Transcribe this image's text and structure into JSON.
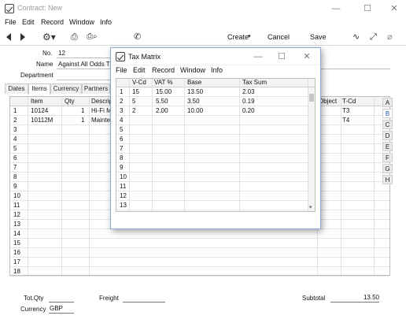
{
  "app": {
    "title": "Contract: New"
  },
  "window_buttons": {
    "minimize": "—",
    "maximize": "☐",
    "close": "✕"
  },
  "menu": [
    "File",
    "Edit",
    "Record",
    "Window",
    "Info"
  ],
  "toolbar": {
    "create_label": "Create",
    "cancel_label": "Cancel",
    "save_label": "Save"
  },
  "header": {
    "no_label": "No.",
    "no_value": "12",
    "name_label": "Name",
    "name_value": "Against All Odds Tra",
    "department_label": "Department",
    "department_value": ""
  },
  "tabs": [
    "Dates",
    "Items",
    "Currency",
    "Partners"
  ],
  "items_grid": {
    "columns": [
      "Item",
      "Qty",
      "Descrip",
      "Object",
      "T-Cd"
    ],
    "rows": [
      {
        "n": "1",
        "item": "10124",
        "qty": "1",
        "desc": "Hi-Fi M",
        "tcd": "T3"
      },
      {
        "n": "2",
        "item": "10112M",
        "qty": "1",
        "desc": "Mainte",
        "tcd": "T4"
      },
      {
        "n": "3"
      },
      {
        "n": "4"
      },
      {
        "n": "5"
      },
      {
        "n": "6"
      },
      {
        "n": "7"
      },
      {
        "n": "8"
      },
      {
        "n": "9"
      },
      {
        "n": "10"
      },
      {
        "n": "11"
      },
      {
        "n": "12"
      },
      {
        "n": "13"
      },
      {
        "n": "14"
      },
      {
        "n": "15"
      },
      {
        "n": "16"
      },
      {
        "n": "17"
      },
      {
        "n": "18"
      }
    ]
  },
  "letter_tabs": [
    "A",
    "B",
    "C",
    "D",
    "E",
    "F",
    "G",
    "H"
  ],
  "footer": {
    "totqty_label": "Tot.Qty",
    "totqty_value": "",
    "freight_label": "Freight",
    "freight_value": "",
    "subtotal_label": "Subtotal",
    "subtotal_value": "13.50",
    "currency_label": "Currency",
    "currency_value": "GBP"
  },
  "tax_matrix": {
    "title": "Tax Matrix",
    "menu": [
      "File",
      "Edit",
      "Record",
      "Window",
      "Info"
    ],
    "columns": [
      "V-Cd",
      "VAT %",
      "Base",
      "Tax Sum"
    ],
    "rows": [
      {
        "n": "1",
        "vcd": "15",
        "vat": "15.00",
        "base": "13.50",
        "tax": "2.03"
      },
      {
        "n": "2",
        "vcd": "5",
        "vat": "5.50",
        "base": "3.50",
        "tax": "0.19"
      },
      {
        "n": "3",
        "vcd": "2",
        "vat": "2.00",
        "base": "10.00",
        "tax": "0.20"
      },
      {
        "n": "4"
      },
      {
        "n": "5"
      },
      {
        "n": "6"
      },
      {
        "n": "7"
      },
      {
        "n": "8"
      },
      {
        "n": "9"
      },
      {
        "n": "10"
      },
      {
        "n": "11"
      },
      {
        "n": "12"
      },
      {
        "n": "13"
      }
    ]
  }
}
